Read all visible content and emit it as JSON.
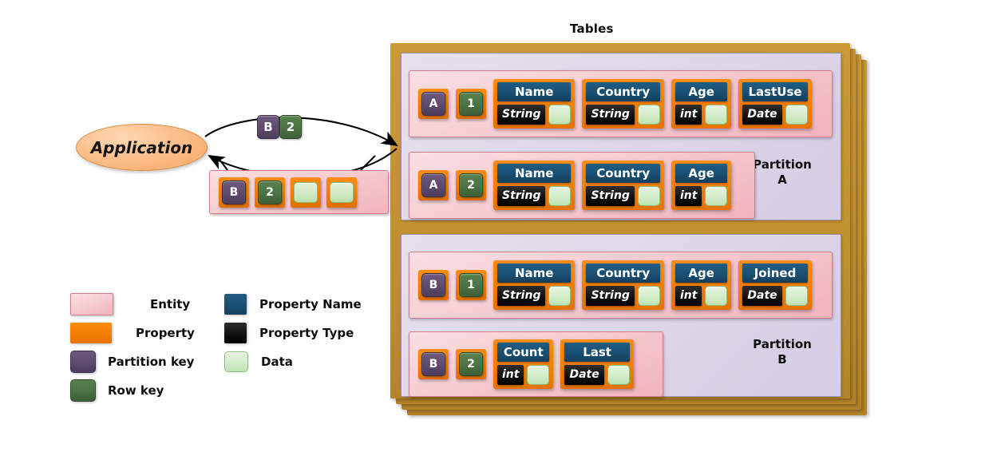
{
  "title": "Tables",
  "application": {
    "label": "Application"
  },
  "request": {
    "partition_key": "B",
    "row_key": "2"
  },
  "result_entity": {
    "partition_key": "B",
    "row_key": "2",
    "data_cells": [
      "",
      ""
    ]
  },
  "partitions": [
    {
      "name": "Partition\nA",
      "name_line1": "Partition",
      "name_line2": "A",
      "entities": [
        {
          "partition_key": "A",
          "row_key": "1",
          "properties": [
            {
              "name": "Name",
              "type": "String",
              "data": ""
            },
            {
              "name": "Country",
              "type": "String",
              "data": ""
            },
            {
              "name": "Age",
              "type": "int",
              "data": ""
            },
            {
              "name": "LastUse",
              "type": "Date",
              "data": ""
            }
          ]
        },
        {
          "partition_key": "A",
          "row_key": "2",
          "properties": [
            {
              "name": "Name",
              "type": "String",
              "data": ""
            },
            {
              "name": "Country",
              "type": "String",
              "data": ""
            },
            {
              "name": "Age",
              "type": "int",
              "data": ""
            }
          ]
        }
      ]
    },
    {
      "name": "Partition\nB",
      "name_line1": "Partition",
      "name_line2": "B",
      "entities": [
        {
          "partition_key": "B",
          "row_key": "1",
          "properties": [
            {
              "name": "Name",
              "type": "String",
              "data": ""
            },
            {
              "name": "Country",
              "type": "String",
              "data": ""
            },
            {
              "name": "Age",
              "type": "int",
              "data": ""
            },
            {
              "name": "Joined",
              "type": "Date",
              "data": ""
            }
          ]
        },
        {
          "partition_key": "B",
          "row_key": "2",
          "properties": [
            {
              "name": "Count",
              "type": "int",
              "data": ""
            },
            {
              "name": "Last",
              "type": "Date",
              "data": ""
            }
          ]
        }
      ]
    }
  ],
  "legend": {
    "items": [
      {
        "key": "entity",
        "label": "Entity"
      },
      {
        "key": "property-name",
        "label": "Property Name"
      },
      {
        "key": "property",
        "label": "Property"
      },
      {
        "key": "property-type",
        "label": "Property Type"
      },
      {
        "key": "partition-key",
        "label": "Partition key"
      },
      {
        "key": "data",
        "label": "Data"
      },
      {
        "key": "row-key",
        "label": "Row key"
      }
    ]
  },
  "colors": {
    "sheet_gold": "#c2912f",
    "partition_lilac": "#ded9e9",
    "entity_pink": "#f6ced3",
    "property_orange": "#f47f06",
    "property_name_blue": "#1a4f72",
    "property_type_black": "#111111",
    "partition_key_purple": "#5d4a6d",
    "row_key_green": "#4b7243",
    "data_green": "#d2ebc8",
    "application_peach": "#fcbf8c"
  }
}
